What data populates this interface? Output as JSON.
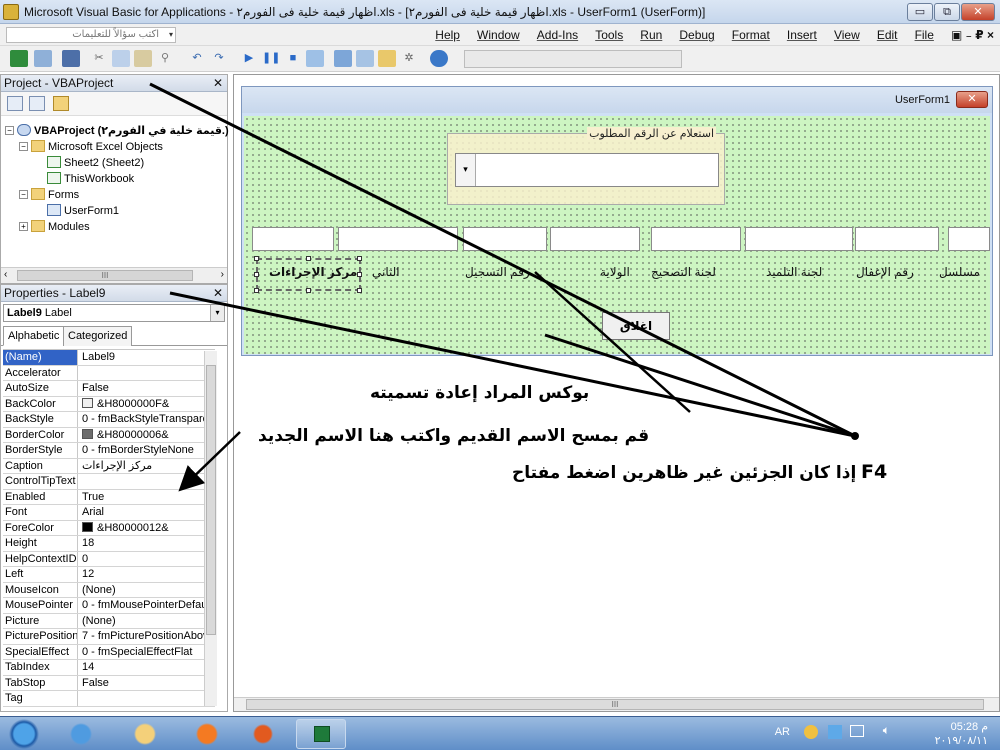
{
  "window": {
    "title": "Microsoft Visual Basic for Applications - اظهار قيمة خلية فى الفورم٢.xls - [اظهار قيمة خلية فى الفورم٢.xls - UserForm1 (UserForm)]",
    "min": "▭",
    "max": "⧉",
    "close": "✕"
  },
  "menubar": {
    "ask_placeholder": "اكتب سؤالاً للتعليمات",
    "ask_dropdown": "▾",
    "items": [
      "Help",
      "Window",
      "Add-Ins",
      "Tools",
      "Run",
      "Debug",
      "Format",
      "Insert",
      "View",
      "Edit",
      "File"
    ],
    "doc_controls": "▣ ₋ ₽ ×"
  },
  "project": {
    "title": "Project - VBAProject",
    "close": "✕",
    "tree": {
      "root": "VBAProject (قيمة خلية في الفورم٢.)",
      "excel_objects": "Microsoft Excel Objects",
      "sheet": "Sheet2 (Sheet2)",
      "workbook": "ThisWorkbook",
      "forms": "Forms",
      "userform": "UserForm1",
      "modules": "Modules"
    },
    "scroll_arrow_left": "‹",
    "scroll_arrow_right": "›",
    "scroll_grip": "III"
  },
  "properties": {
    "title": "Properties - Label9",
    "close": "✕",
    "object_name": "Label9",
    "object_type": "Label",
    "tabs": [
      "Alphabetic",
      "Categorized"
    ],
    "rows": [
      {
        "k": "(Name)",
        "v": "Label9"
      },
      {
        "k": "Accelerator",
        "v": ""
      },
      {
        "k": "AutoSize",
        "v": "False"
      },
      {
        "k": "BackColor",
        "v": "&H8000000F&"
      },
      {
        "k": "BackStyle",
        "v": "0 - fmBackStyleTransparent"
      },
      {
        "k": "BorderColor",
        "v": "&H80000006&"
      },
      {
        "k": "BorderStyle",
        "v": "0 - fmBorderStyleNone"
      },
      {
        "k": "Caption",
        "v": "مركز الإجراءات"
      },
      {
        "k": "ControlTipText",
        "v": ""
      },
      {
        "k": "Enabled",
        "v": "True"
      },
      {
        "k": "Font",
        "v": "Arial"
      },
      {
        "k": "ForeColor",
        "v": "&H80000012&"
      },
      {
        "k": "Height",
        "v": "18"
      },
      {
        "k": "HelpContextID",
        "v": "0"
      },
      {
        "k": "Left",
        "v": "12"
      },
      {
        "k": "MouseIcon",
        "v": "(None)"
      },
      {
        "k": "MousePointer",
        "v": "0 - fmMousePointerDefault"
      },
      {
        "k": "Picture",
        "v": "(None)"
      },
      {
        "k": "PicturePosition",
        "v": "7 - fmPicturePositionAboveCenter"
      },
      {
        "k": "SpecialEffect",
        "v": "0 - fmSpecialEffectFlat"
      },
      {
        "k": "TabIndex",
        "v": "14"
      },
      {
        "k": "TabStop",
        "v": "False"
      },
      {
        "k": "Tag",
        "v": ""
      }
    ],
    "colors": {
      "backcolor": "#f0f0f0",
      "bordercolor": "#6d6d6d",
      "forecolor": "#000000"
    }
  },
  "userform": {
    "title": "UserForm1",
    "close": "✕",
    "frame_caption": "استعلام عن الرقم المطلوب",
    "combo_arrow": "▾",
    "labels": [
      "مسلسل",
      "رقم الإغفال",
      "لجنة التلميذ",
      "لجنة التصحيح",
      "الولاية",
      "رقم التسجيل",
      "الثاني",
      "مركز الإجراءات"
    ],
    "button": "اغلاق"
  },
  "annotations": {
    "line1": "بوكس المراد إعادة تسميته",
    "line2": "قم بمسح الاسم القديم واكتب هنا الاسم الجديد",
    "line3": "إذا كان الجزئين غير ظاهرين اضغط مفتاح",
    "f4": "F4"
  },
  "taskbar": {
    "lang": "AR",
    "time": "05:28 م",
    "date": "٢٠١٩/٠٨/١١"
  }
}
